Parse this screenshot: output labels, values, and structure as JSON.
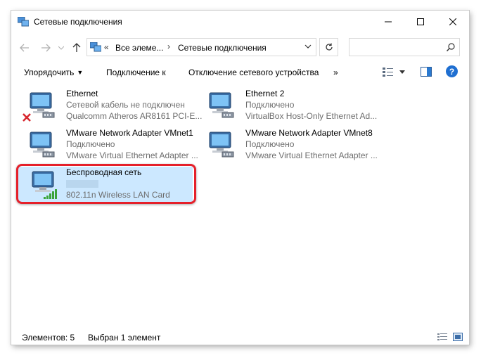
{
  "window": {
    "title": "Сетевые подключения"
  },
  "address": {
    "overflow": "«",
    "segments": [
      "Все элеме...",
      "Сетевые подключения"
    ],
    "search_placeholder": ""
  },
  "commands": {
    "organize": "Упорядочить",
    "connect": "Подключение к",
    "disconnect": "Отключение сетевого устройства",
    "more": "»"
  },
  "items": [
    {
      "name": "Ethernet",
      "status": "Сетевой кабель не подключен",
      "device": "Qualcomm Atheros AR8161 PCI-E...",
      "state": "disconnected"
    },
    {
      "name": "Ethernet 2",
      "status": "Подключено",
      "device": "VirtualBox Host-Only Ethernet Ad...",
      "state": "connected"
    },
    {
      "name": "VMware Network Adapter VMnet1",
      "status": "Подключено",
      "device": "VMware Virtual Ethernet Adapter ...",
      "state": "connected"
    },
    {
      "name": "VMware Network Adapter VMnet8",
      "status": "Подключено",
      "device": "VMware Virtual Ethernet Adapter ...",
      "state": "connected"
    },
    {
      "name": "Беспроводная сеть",
      "status": "",
      "device": "802.11n Wireless LAN Card",
      "state": "wireless",
      "selected": true
    }
  ],
  "status": {
    "count": "Элементов: 5",
    "selection": "Выбран 1 элемент"
  },
  "colors": {
    "selection": "#cce8ff",
    "highlight": "#e5202a",
    "help": "#1f6fd1"
  }
}
